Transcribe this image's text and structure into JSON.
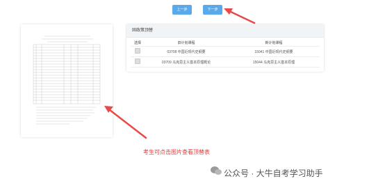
{
  "toolbar": {
    "prev_label": "上一步",
    "next_label": "下一步"
  },
  "panel": {
    "title": "固政策顶替",
    "columns": [
      "选择",
      "旧计划课程",
      "新计划课程"
    ],
    "rows": [
      {
        "old": "03708 中国近现代史纲要",
        "new": "15041 中国近现代史纲要"
      },
      {
        "old": "03709 马克思主义基本原理概论",
        "new": "15044 马克思主义基本原理"
      }
    ]
  },
  "caption": "考生可点击图片查看顶替表",
  "watermark": "公众号 · 大牛自考学习助手",
  "colors": {
    "button": "#5aa9ea",
    "arrow": "#e84a4a",
    "caption": "#e03a3a"
  }
}
